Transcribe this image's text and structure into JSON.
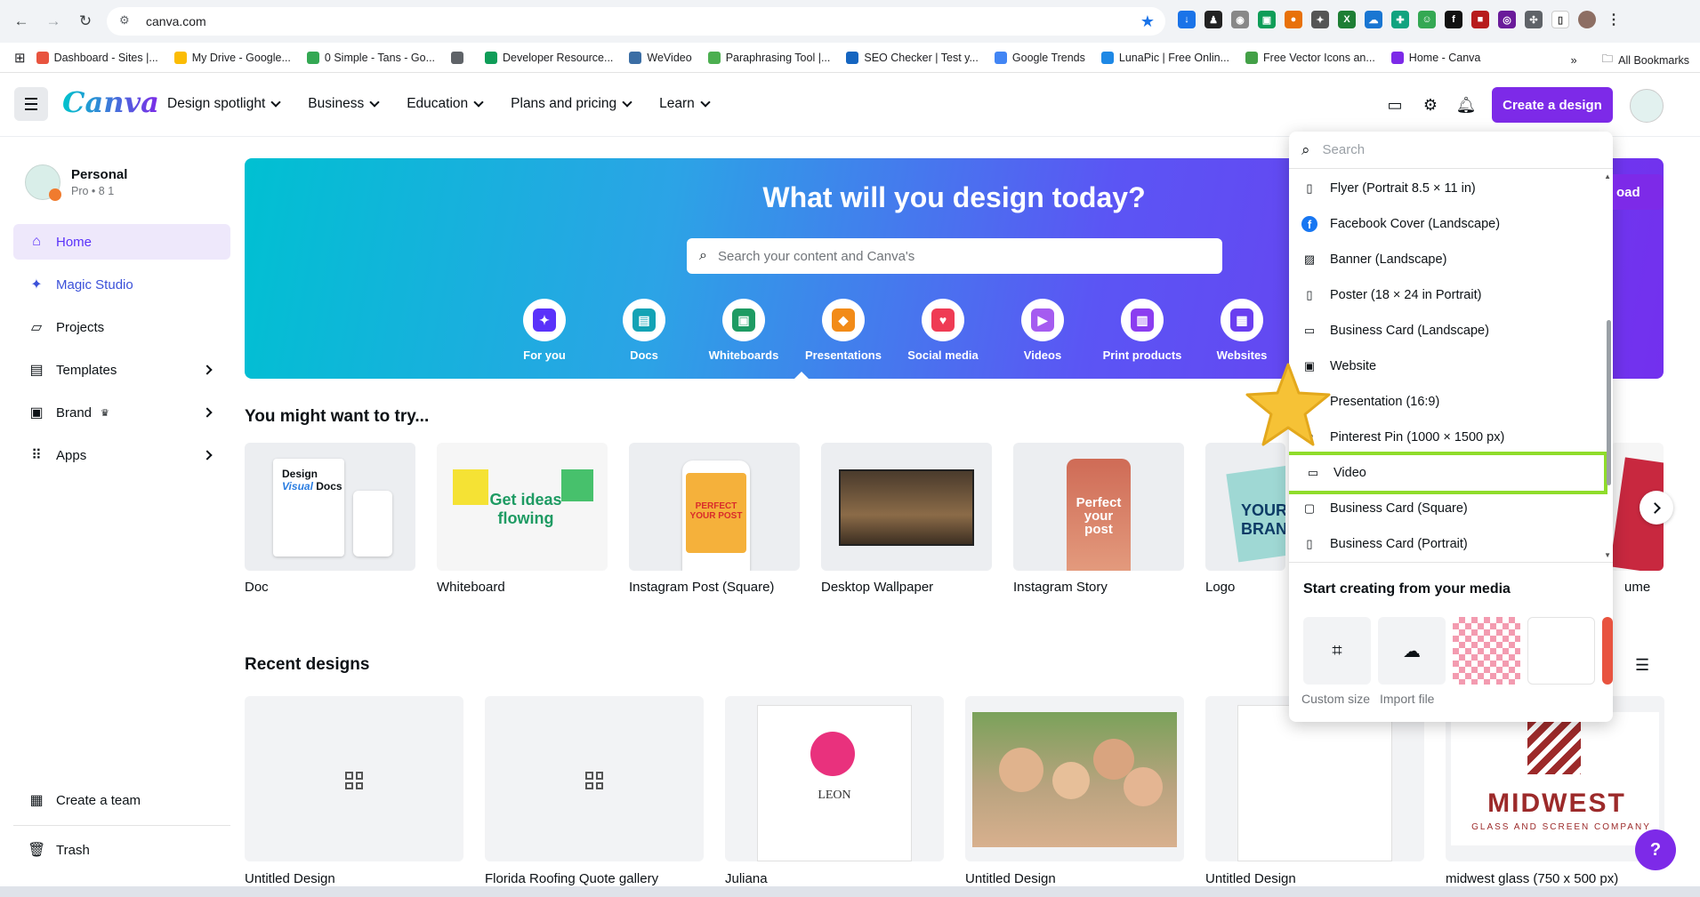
{
  "browser": {
    "url": "canva.com",
    "bookmarks": [
      {
        "label": "Dashboard - Sites |...",
        "color": "#e8543f"
      },
      {
        "label": "My Drive - Google...",
        "color": "#fbbc04"
      },
      {
        "label": "0 Simple - Tans - Go...",
        "color": "#34a853"
      },
      {
        "label": "",
        "color": "#5f6368"
      },
      {
        "label": "Developer Resource...",
        "color": "#0f9d58"
      },
      {
        "label": "WeVideo",
        "color": "#3b6ea5"
      },
      {
        "label": "Paraphrasing Tool |...",
        "color": "#4caf50"
      },
      {
        "label": "SEO Checker | Test y...",
        "color": "#1565c0"
      },
      {
        "label": "Google Trends",
        "color": "#4285f4"
      },
      {
        "label": "LunaPic | Free Onlin...",
        "color": "#1e88e5"
      },
      {
        "label": "Free Vector Icons an...",
        "color": "#43a047"
      },
      {
        "label": "Home - Canva",
        "color": "#7d2ae8"
      }
    ],
    "all_bookmarks": "All Bookmarks"
  },
  "header": {
    "logo": "Canva",
    "nav": [
      "Design spotlight",
      "Business",
      "Education",
      "Plans and pricing",
      "Learn"
    ],
    "create_button": "Create a design"
  },
  "sidebar": {
    "account_name": "Personal",
    "account_sub": "Pro • 8 1",
    "items": [
      {
        "label": "Home",
        "icon": "home-icon"
      },
      {
        "label": "Magic Studio",
        "icon": "sparkle-icon"
      },
      {
        "label": "Projects",
        "icon": "folder-icon"
      },
      {
        "label": "Templates",
        "icon": "templates-icon"
      },
      {
        "label": "Brand",
        "icon": "brand-icon"
      },
      {
        "label": "Apps",
        "icon": "apps-icon"
      }
    ],
    "create_team": "Create a team",
    "trash": "Trash"
  },
  "hero": {
    "title": "What will you design today?",
    "search_placeholder": "Search your content and Canva's",
    "categories": [
      {
        "label": "For you",
        "color": "#5a32fa"
      },
      {
        "label": "Docs",
        "color": "#13a3b5"
      },
      {
        "label": "Whiteboards",
        "color": "#1e9b63"
      },
      {
        "label": "Presentations",
        "color": "#f28b18"
      },
      {
        "label": "Social media",
        "color": "#ef3b54"
      },
      {
        "label": "Videos",
        "color": "#a55cf0"
      },
      {
        "label": "Print products",
        "color": "#8b3df0"
      },
      {
        "label": "Websites",
        "color": "#6a3ef0"
      }
    ]
  },
  "try_section": {
    "title": "You might want to try...",
    "cards": [
      "Doc",
      "Whiteboard",
      "Instagram Post (Square)",
      "Desktop Wallpaper",
      "Instagram Story",
      "Logo"
    ],
    "partial_label": "ume"
  },
  "recent": {
    "title": "Recent designs",
    "cards": [
      "Untitled Design",
      "Florida Roofing Quote gallery",
      "Juliana",
      "Untitled Design",
      "Untitled Design",
      "midwest glass (750 x 500 px)"
    ],
    "logo_text": "LEON",
    "midwest_text": "MIDWEST",
    "midwest_sub": "GLASS AND SCREEN COMPANY"
  },
  "dropdown": {
    "search_placeholder": "Search",
    "items": [
      "Flyer (Portrait 8.5 × 11 in)",
      "Facebook Cover (Landscape)",
      "Banner (Landscape)",
      "Poster (18 × 24 in Portrait)",
      "Business Card (Landscape)",
      "Website",
      "Presentation (16:9)",
      "Pinterest Pin (1000 × 1500 px)",
      "Video",
      "Business Card (Square)",
      "Business Card (Portrait)"
    ],
    "highlighted_index": 8,
    "media_title": "Start creating from your media",
    "custom_size": "Custom size",
    "import_file": "Import file"
  },
  "colors": {
    "brand": "#7d2ae8",
    "highlight": "#8fdc2b"
  }
}
